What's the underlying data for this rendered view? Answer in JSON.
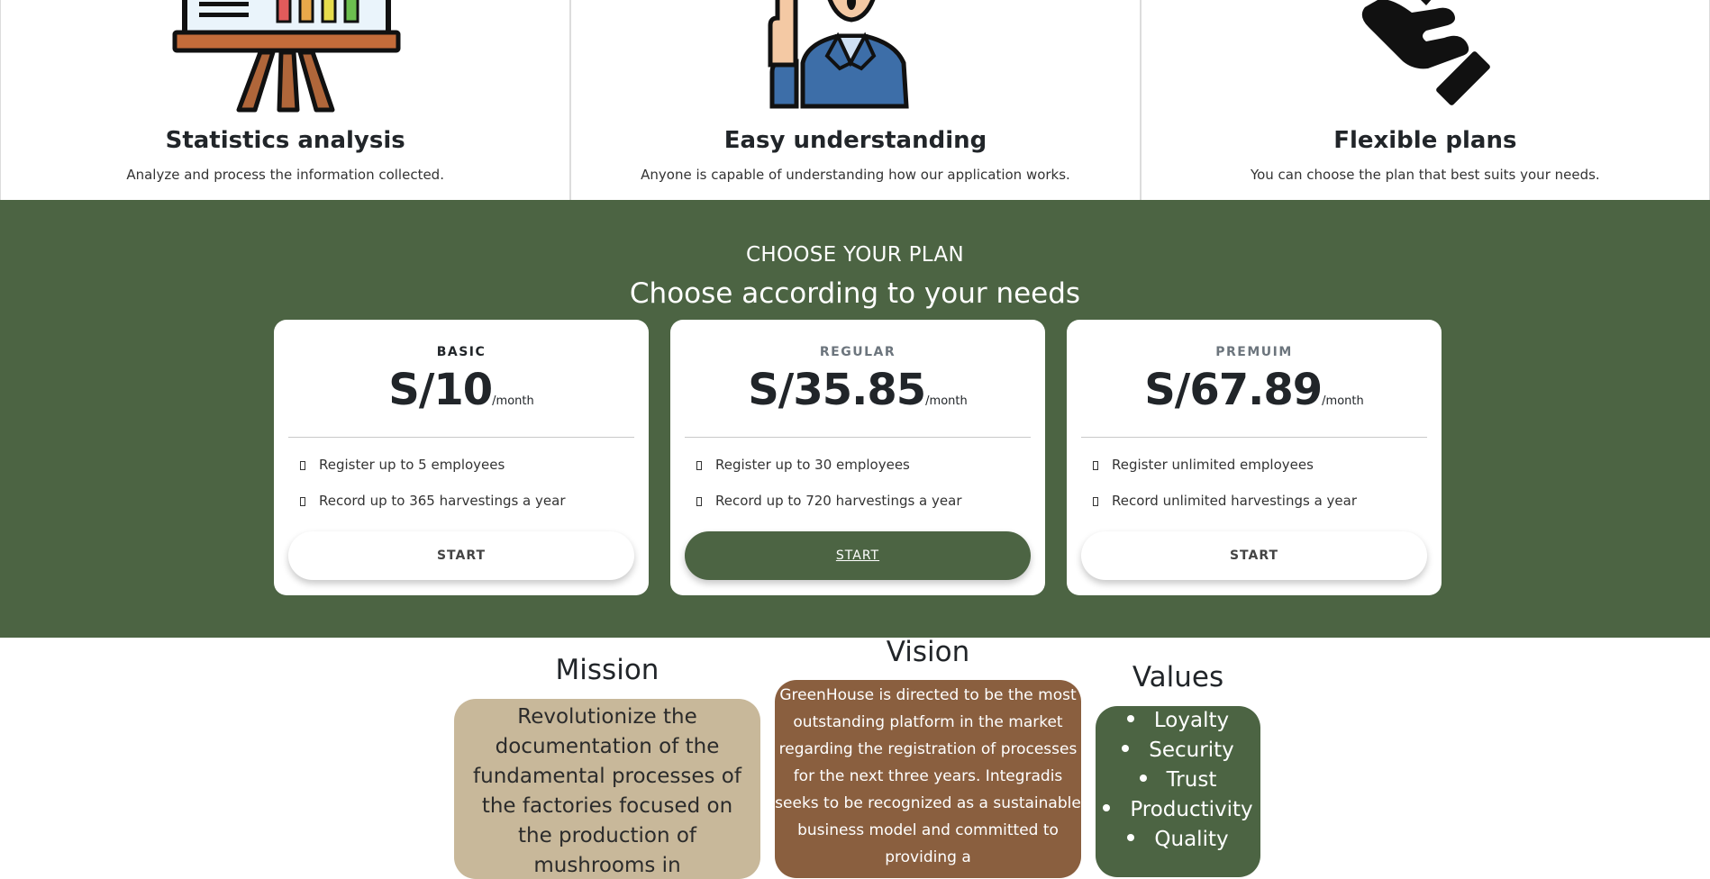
{
  "features": [
    {
      "title": "Statistics analysis",
      "description": "Analyze and process the information collected.",
      "icon": "presentation-board-icon"
    },
    {
      "title": "Easy understanding",
      "description": "Anyone is capable of understanding how our application works.",
      "icon": "teacher-icon"
    },
    {
      "title": "Flexible plans",
      "description": "You can choose the plan that best suits your needs.",
      "icon": "hand-icon"
    }
  ],
  "plans_section": {
    "kicker": "CHOOSE YOUR PLAN",
    "title": "Choose according to your needs",
    "plans": [
      {
        "name": "BASIC",
        "price": "S/10",
        "period": "/month",
        "features": [
          "Register up to 5 employees",
          "Record up to 365 harvestings a year"
        ],
        "button": "START"
      },
      {
        "name": "REGULAR",
        "price": "S/35.85",
        "period": "/month",
        "features": [
          "Register up to 30 employees",
          "Record up to 720 harvestings a year"
        ],
        "button": "START"
      },
      {
        "name": "PREMUIM",
        "price": "S/67.89",
        "period": "/month",
        "features": [
          "Register unlimited employees",
          "Record unlimited harvestings a year"
        ],
        "button": "START"
      }
    ]
  },
  "mission": {
    "title": "Mission",
    "text": "Revolutionize the documentation of the fundamental processes of the factories focused on the production of mushrooms in"
  },
  "vision": {
    "title": "Vision",
    "text": "GreenHouse is directed to be the most outstanding platform in the market regarding the registration of processes for the next three years. Integradis seeks to be recognized as a sustainable business model and committed to providing a"
  },
  "values": {
    "title": "Values",
    "items": [
      "Loyalty",
      "Security",
      "Trust",
      "Productivity",
      "Quality"
    ]
  },
  "colors": {
    "section_green": "#4c6443",
    "mission_tan": "#c8b89a",
    "vision_brown": "#8a5f3f"
  }
}
